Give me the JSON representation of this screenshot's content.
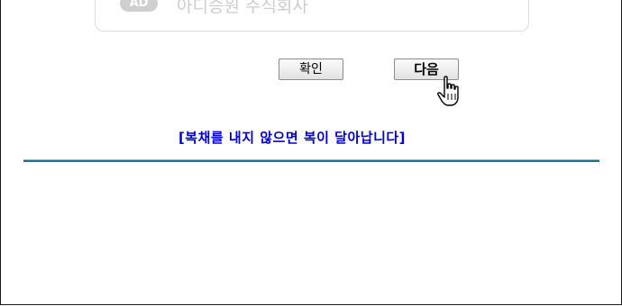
{
  "ad": {
    "badge": "AD",
    "text": "아디승원 주식회사"
  },
  "buttons": {
    "confirm_label": "확인",
    "next_label": "다음"
  },
  "notice": {
    "text": "[복채를 내지 않으면 복이 달아납니다]",
    "color": "#0000cc"
  },
  "colors": {
    "divider": "#1f6f8f"
  }
}
